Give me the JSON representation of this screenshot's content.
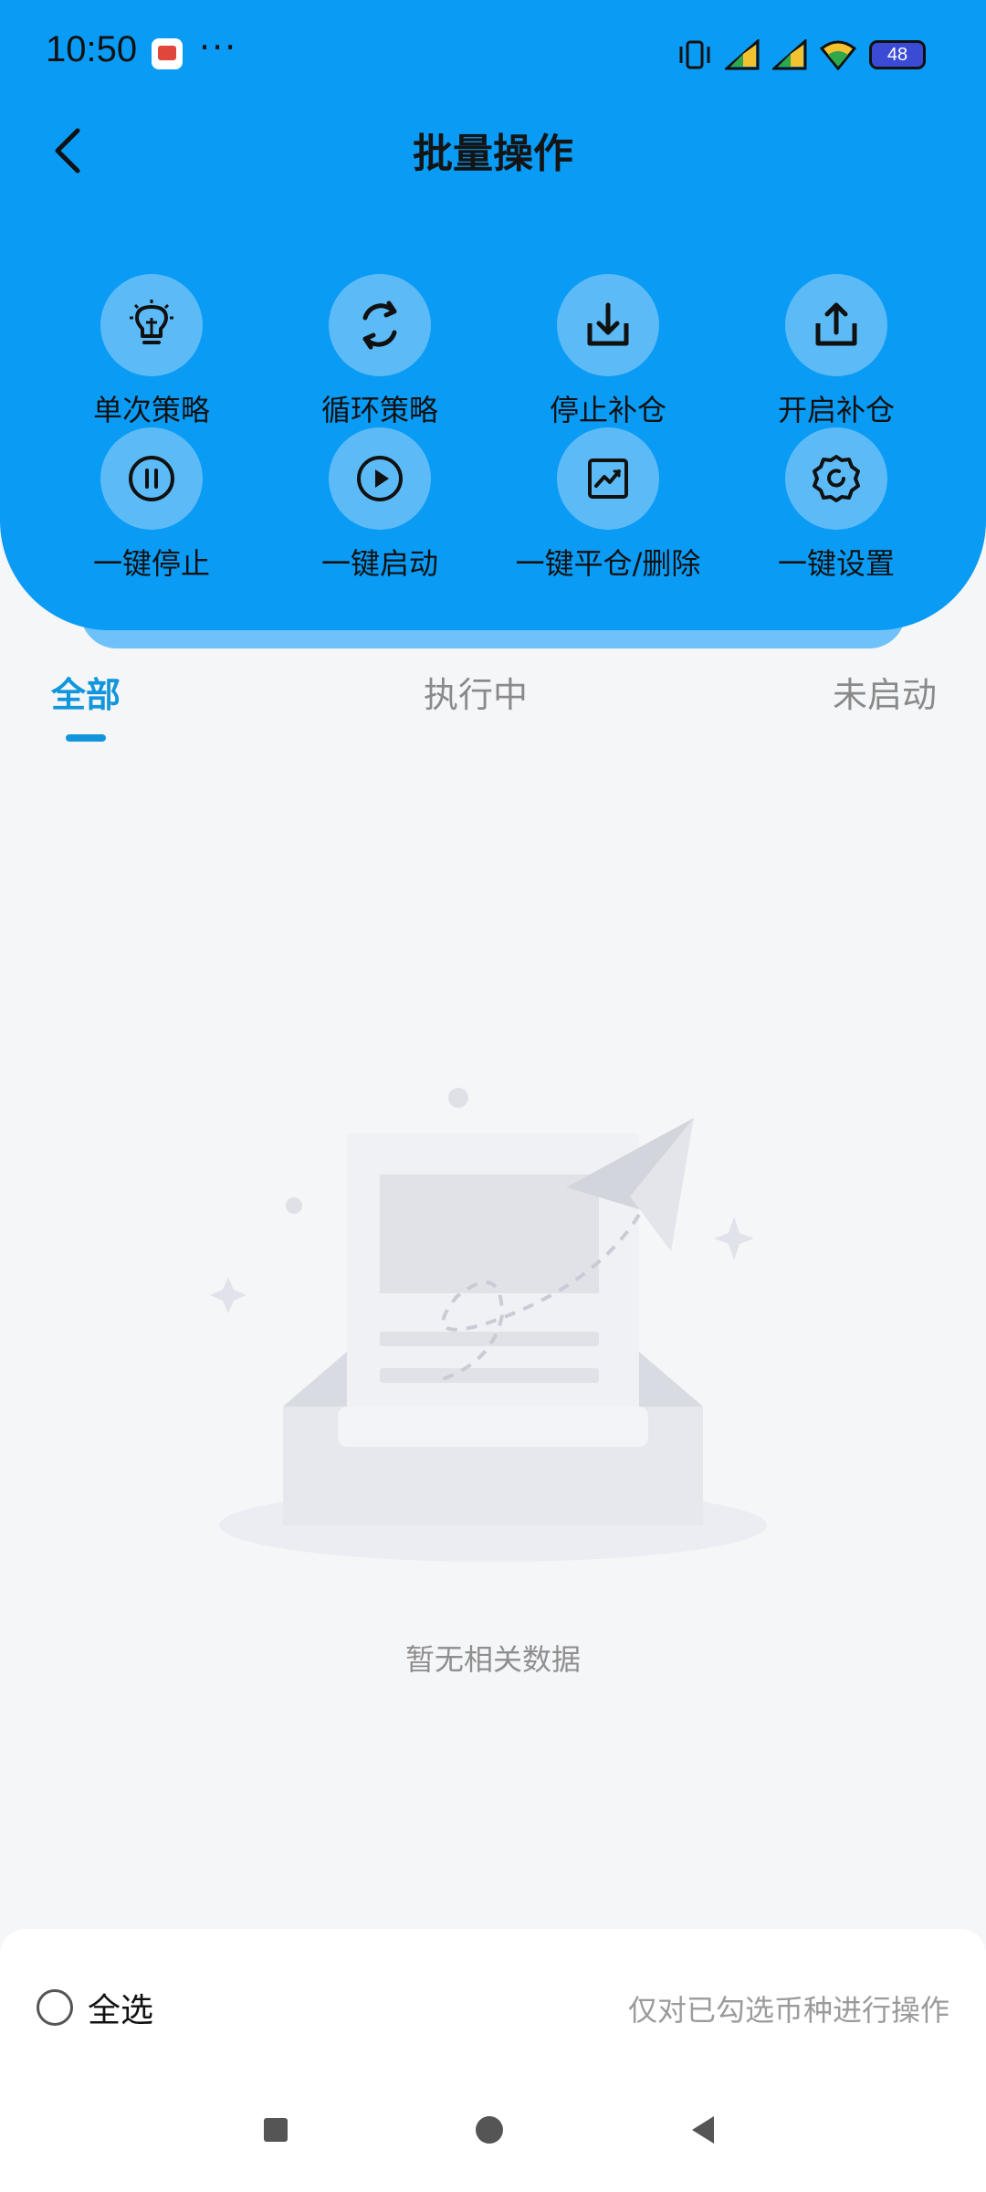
{
  "status_bar": {
    "time": "10:50",
    "extra": "···",
    "battery": "48",
    "icons": [
      "notification-app-icon",
      "vibrate-icon",
      "signal-icon",
      "signal-icon",
      "wifi-icon",
      "battery-icon"
    ]
  },
  "header": {
    "title": "批量操作",
    "back_icon": "chevron-left-icon"
  },
  "actions": [
    {
      "label": "单次策略",
      "icon": "lightbulb-icon"
    },
    {
      "label": "循环策略",
      "icon": "refresh-cycle-icon"
    },
    {
      "label": "停止补仓",
      "icon": "download-tray-icon"
    },
    {
      "label": "开启补仓",
      "icon": "upload-share-icon"
    },
    {
      "label": "一键停止",
      "icon": "pause-circle-icon"
    },
    {
      "label": "一键启动",
      "icon": "play-circle-icon"
    },
    {
      "label": "一键平仓/删除",
      "icon": "chart-trend-icon"
    },
    {
      "label": "一键设置",
      "icon": "gear-icon"
    }
  ],
  "tabs": [
    {
      "label": "全部",
      "active": true
    },
    {
      "label": "执行中",
      "active": false
    },
    {
      "label": "未启动",
      "active": false
    }
  ],
  "empty": {
    "message": "暂无相关数据"
  },
  "footer": {
    "select_all": "全选",
    "hint": "仅对已勾选币种进行操作"
  },
  "colors": {
    "header_blue": "#0a9bf5",
    "tab_active": "#1296db"
  }
}
